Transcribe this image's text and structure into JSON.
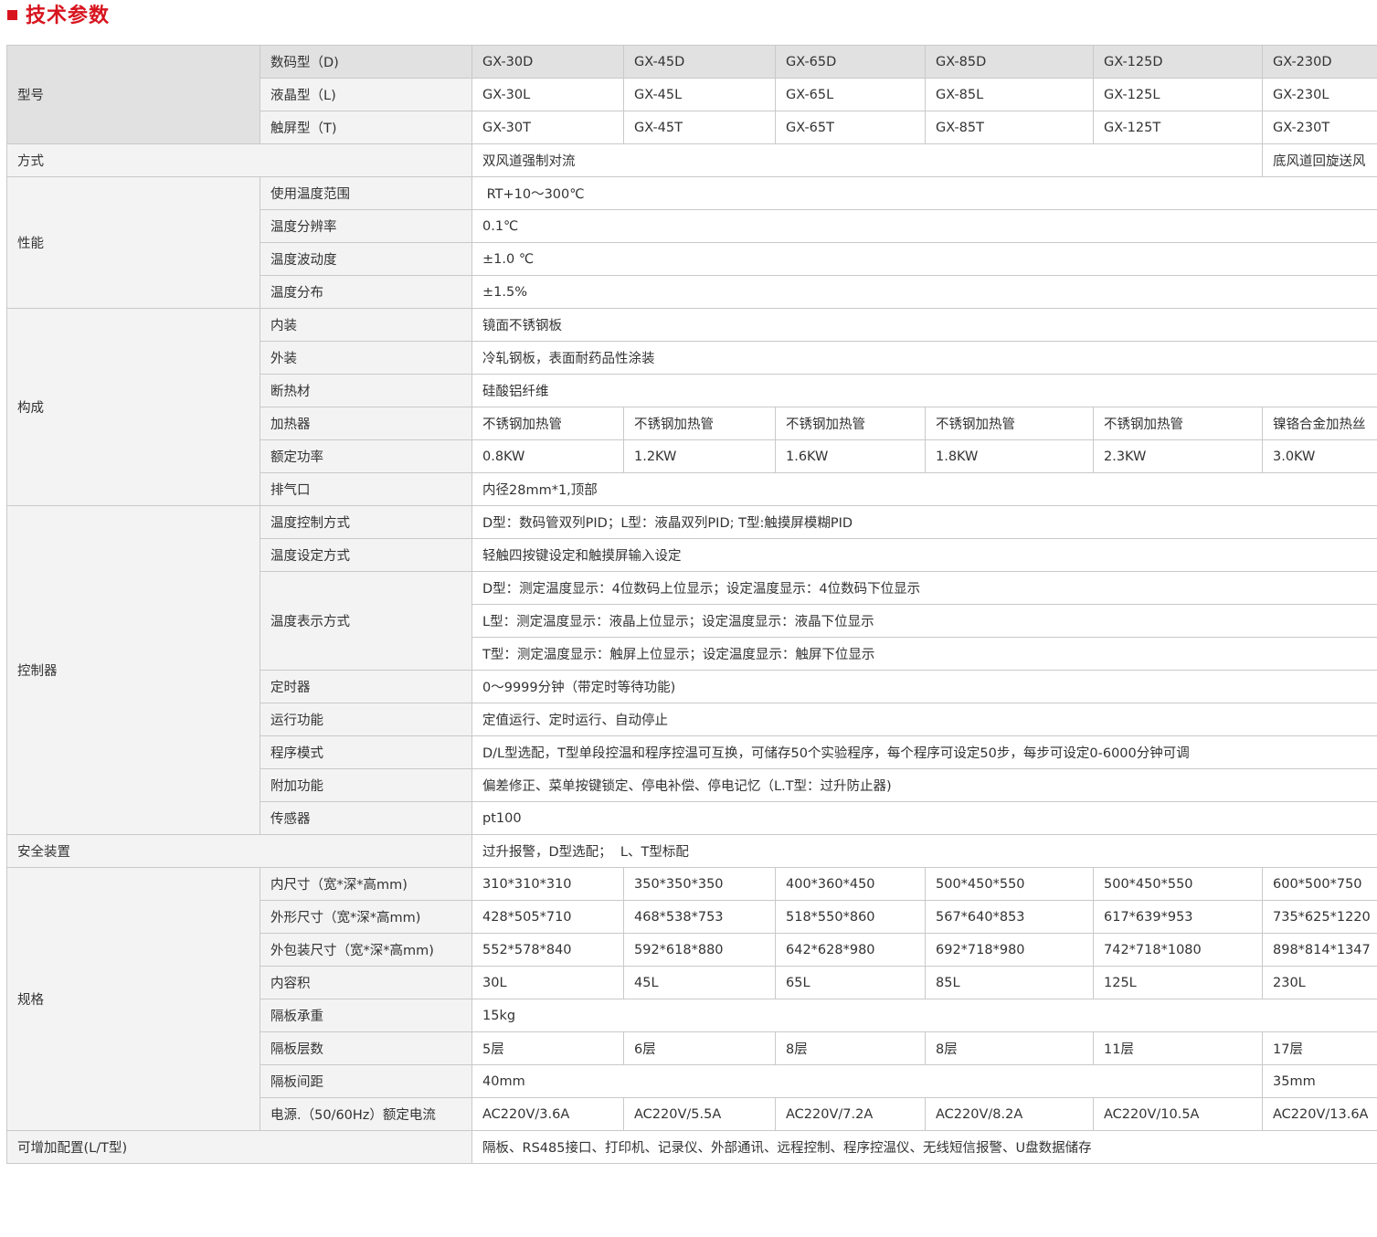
{
  "title": "技术参数",
  "colors": {
    "accent": "#d7141e",
    "label_bg": "#f3f3f3",
    "header_bg": "#e1e1e1",
    "border": "#c9c9c9"
  },
  "model": {
    "label": "型号",
    "digital": {
      "label": "数码型（D)",
      "values": [
        "GX-30D",
        "GX-45D",
        "GX-65D",
        "GX-85D",
        "GX-125D",
        "GX-230D"
      ]
    },
    "lcd": {
      "label": "液晶型（L)",
      "values": [
        "GX-30L",
        "GX-45L",
        "GX-65L",
        "GX-85L",
        "GX-125L",
        "GX-230L"
      ]
    },
    "touch": {
      "label": "触屏型（T)",
      "values": [
        "GX-30T",
        "GX-45T",
        "GX-65T",
        "GX-85T",
        "GX-125T",
        "GX-230T"
      ]
    }
  },
  "method": {
    "label": "方式",
    "main": "双风道强制对流",
    "last": "底风道回旋送风"
  },
  "performance": {
    "label": "性能",
    "range": {
      "label": "使用温度范围",
      "value": " RT+10～300℃"
    },
    "resolution": {
      "label": "温度分辨率",
      "value": "0.1℃"
    },
    "fluctuation": {
      "label": "温度波动度",
      "value": "±1.0 ℃"
    },
    "distribution": {
      "label": "温度分布",
      "value": "±1.5%"
    }
  },
  "construction": {
    "label": "构成",
    "inner": {
      "label": "内装",
      "value": "镜面不锈钢板"
    },
    "outer": {
      "label": "外装",
      "value": "冷轧钢板，表面耐药品性涂装"
    },
    "insulation": {
      "label": "断热材",
      "value": "硅酸铝纤维"
    },
    "heater": {
      "label": "加热器",
      "values": [
        "不锈钢加热管",
        "不锈钢加热管",
        "不锈钢加热管",
        "不锈钢加热管",
        "不锈钢加热管",
        "镍铬合金加热丝"
      ]
    },
    "power": {
      "label": "额定功率",
      "values": [
        "0.8KW",
        "1.2KW",
        "1.6KW",
        "1.8KW",
        "2.3KW",
        "3.0KW"
      ]
    },
    "vent": {
      "label": "排气口",
      "value": "内径28mm*1,顶部"
    }
  },
  "controller": {
    "label": "控制器",
    "control_mode": {
      "label": "温度控制方式",
      "value": "D型：数码管双列PID；L型：液晶双列PID; T型:触摸屏模糊PID"
    },
    "setting_mode": {
      "label": "温度设定方式",
      "value": "轻触四按键设定和触摸屏输入设定"
    },
    "display_mode": {
      "label": "温度表示方式",
      "d": "D型：测定温度显示：4位数码上位显示；设定温度显示：4位数码下位显示",
      "l": "L型：测定温度显示：液晶上位显示；设定温度显示：液晶下位显示",
      "t": "T型：测定温度显示：触屏上位显示；设定温度显示：触屏下位显示"
    },
    "timer": {
      "label": "定时器",
      "value": "0～9999分钟（带定时等待功能)"
    },
    "run": {
      "label": "运行功能",
      "value": "定值运行、定时运行、自动停止"
    },
    "program": {
      "label": "程序模式",
      "value": "D/L型选配，T型单段控温和程序控温可互换，可储存50个实验程序，每个程序可设定50步，每步可设定0-6000分钟可调"
    },
    "extra": {
      "label": "附加功能",
      "value": "偏差修正、菜单按键锁定、停电补偿、停电记忆（L.T型：过升防止器)"
    },
    "sensor": {
      "label": "传感器",
      "value": "pt100"
    }
  },
  "safety": {
    "label": "安全装置",
    "value": "过升报警，D型选配；  L、T型标配"
  },
  "spec": {
    "label": "规格",
    "inner_size": {
      "label": "内尺寸（宽*深*高mm)",
      "values": [
        "310*310*310",
        "350*350*350",
        "400*360*450",
        "500*450*550",
        "500*450*550",
        "600*500*750"
      ]
    },
    "outer_size": {
      "label": "外形尺寸（宽*深*高mm)",
      "values": [
        "428*505*710",
        "468*538*753",
        "518*550*860",
        "567*640*853",
        "617*639*953",
        "735*625*1220"
      ]
    },
    "package_size": {
      "label": "外包装尺寸（宽*深*高mm)",
      "values": [
        "552*578*840",
        "592*618*880",
        "642*628*980",
        "692*718*980",
        "742*718*1080",
        "898*814*1347"
      ]
    },
    "volume": {
      "label": "内容积",
      "values": [
        "30L",
        "45L",
        "65L",
        "85L",
        "125L",
        "230L"
      ]
    },
    "shelf_load": {
      "label": "隔板承重",
      "value": "15kg"
    },
    "shelf_layers": {
      "label": "隔板层数",
      "values": [
        "5层",
        "6层",
        "8层",
        "8层",
        "11层",
        "17层"
      ]
    },
    "shelf_spacing": {
      "label": "隔板间距",
      "main": "40mm",
      "last": "35mm"
    },
    "power_supply": {
      "label": "电源.（50/60Hz）额定电流",
      "values": [
        "AC220V/3.6A",
        "AC220V/5.5A",
        "AC220V/7.2A",
        "AC220V/8.2A",
        "AC220V/10.5A",
        "AC220V/13.6A"
      ]
    }
  },
  "options": {
    "label": "可增加配置(L/T型)",
    "value": "隔板、RS485接口、打印机、记录仪、外部通讯、远程控制、程序控温仪、无线短信报警、U盘数据储存"
  }
}
